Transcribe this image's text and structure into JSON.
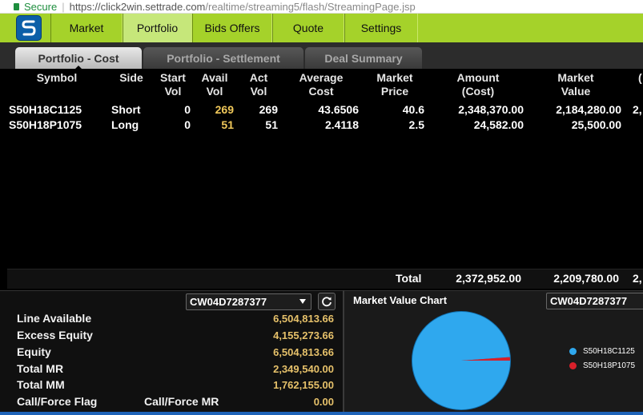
{
  "browser": {
    "secure_label": "Secure",
    "url_host": "https://click2win.settrade.com",
    "url_rest": "/realtime/streaming5/flash/StreamingPage.jsp"
  },
  "menu": {
    "items": [
      {
        "label": "Market"
      },
      {
        "label": "Portfolio"
      },
      {
        "label": "Bids Offers"
      },
      {
        "label": "Quote"
      },
      {
        "label": "Settings"
      }
    ],
    "active": "Portfolio"
  },
  "subtabs": {
    "items": [
      {
        "label": "Portfolio - Cost"
      },
      {
        "label": "Portfolio - Settlement"
      },
      {
        "label": "Deal Summary"
      }
    ],
    "active": "Portfolio - Cost"
  },
  "table": {
    "headers": {
      "symbol": "Symbol",
      "side": "Side",
      "start_vol": [
        "Start",
        "Vol"
      ],
      "avail_vol": [
        "Avail",
        "Vol"
      ],
      "act_vol": [
        "Act",
        "Vol"
      ],
      "avg_cost": [
        "Average",
        "Cost"
      ],
      "market_price": [
        "Market",
        "Price"
      ],
      "amount_cost": [
        "Amount",
        "(Cost)"
      ],
      "market_value": [
        "Market",
        "Value"
      ],
      "next_col_cut": "("
    },
    "rows": [
      {
        "symbol": "S50H18C1125",
        "side": "Short",
        "start_vol": "0",
        "avail_vol": "269",
        "act_vol": "269",
        "avg_cost": "43.6506",
        "market_price": "40.6",
        "amount_cost": "2,348,370.00",
        "market_value": "2,184,280.00",
        "next_col_cut": "2,"
      },
      {
        "symbol": "S50H18P1075",
        "side": "Long",
        "start_vol": "0",
        "avail_vol": "51",
        "act_vol": "51",
        "avg_cost": "2.4118",
        "market_price": "2.5",
        "amount_cost": "24,582.00",
        "market_value": "25,500.00",
        "next_col_cut": ""
      }
    ],
    "total": {
      "label": "Total",
      "amount_cost": "2,372,952.00",
      "market_value": "2,209,780.00",
      "next_col_cut": "2,"
    }
  },
  "account": {
    "selected": "CW04D7287377",
    "rows": [
      {
        "label": "Line Available",
        "value": "6,504,813.66"
      },
      {
        "label": "Excess Equity",
        "value": "4,155,273.66"
      },
      {
        "label": "Equity",
        "value": "6,504,813.66"
      },
      {
        "label": "Total MR",
        "value": "2,349,540.00"
      },
      {
        "label": "Total MM",
        "value": "1,762,155.00"
      },
      {
        "label": "Call/Force Flag",
        "label2": "Call/Force MR",
        "value": "0.00"
      }
    ]
  },
  "chart_panel": {
    "title": "Market Value Chart",
    "selected": "CW04D7287377"
  },
  "chart_data": {
    "type": "pie",
    "title": "Market Value Chart",
    "categories": [
      "S50H18C1125",
      "S50H18P1075"
    ],
    "values": [
      2184280.0,
      25500.0
    ],
    "colors": [
      "#2fa8ee",
      "#d8202a"
    ],
    "legend": "right"
  },
  "colors": {
    "menubar": "#a5d22a",
    "value_yellow": "#e6c16a",
    "logo_blue": "#0b5fa8"
  }
}
